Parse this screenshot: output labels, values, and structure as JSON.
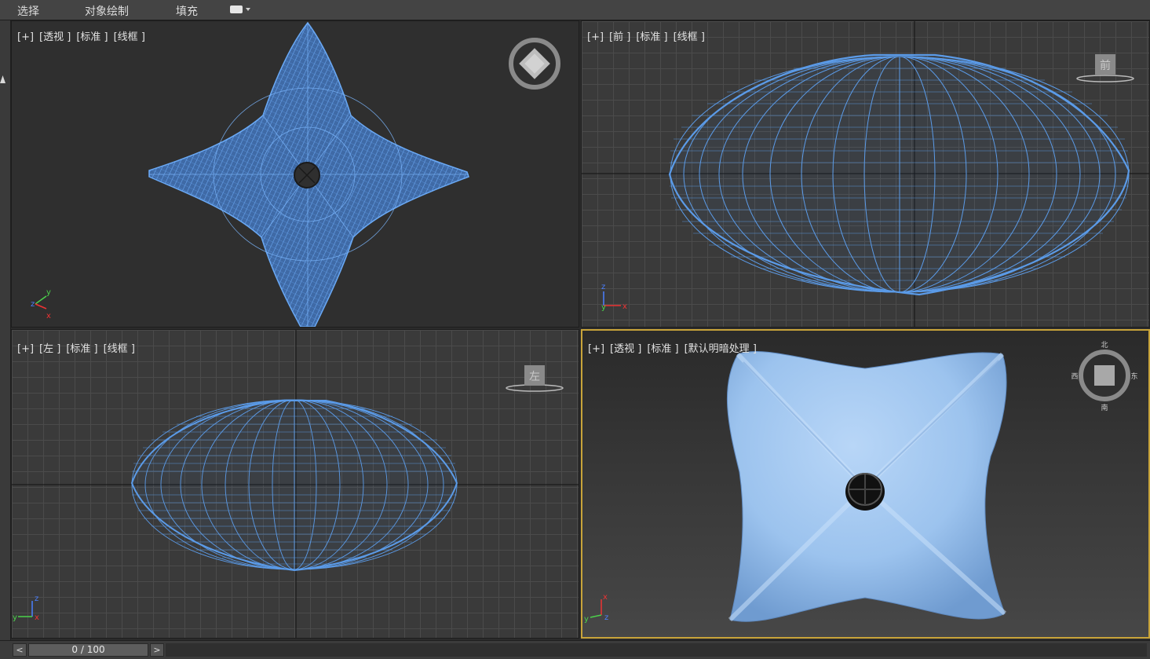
{
  "menubar": {
    "items": [
      "选择",
      "对象绘制",
      "填充"
    ]
  },
  "viewports": {
    "top": {
      "labels": [
        "[+]",
        "[透视 ]",
        "[标准 ]",
        "[线框 ]"
      ],
      "gizmo": "viewcube-top"
    },
    "front": {
      "labels": [
        "[+]",
        "[前 ]",
        "[标准 ]",
        "[线框 ]"
      ],
      "cube_face": "前"
    },
    "left": {
      "labels": [
        "[+]",
        "[左 ]",
        "[标准 ]",
        "[线框 ]"
      ],
      "cube_face": "左"
    },
    "perspective": {
      "labels": [
        "[+]",
        "[透视 ]",
        "[标准 ]",
        "[默认明暗处理 ]"
      ],
      "compass": [
        "北",
        "东",
        "南",
        "西"
      ]
    }
  },
  "axes": {
    "x": "x",
    "y": "y",
    "z": "z"
  },
  "timeslider": {
    "prev": "<",
    "next": ">",
    "position": "0 / 100",
    "current_frame": 0,
    "total_frames": 100
  },
  "colors": {
    "wire": "#5b9be8",
    "shaded": "#9cc3ee",
    "active_border": "#c8a43a"
  }
}
